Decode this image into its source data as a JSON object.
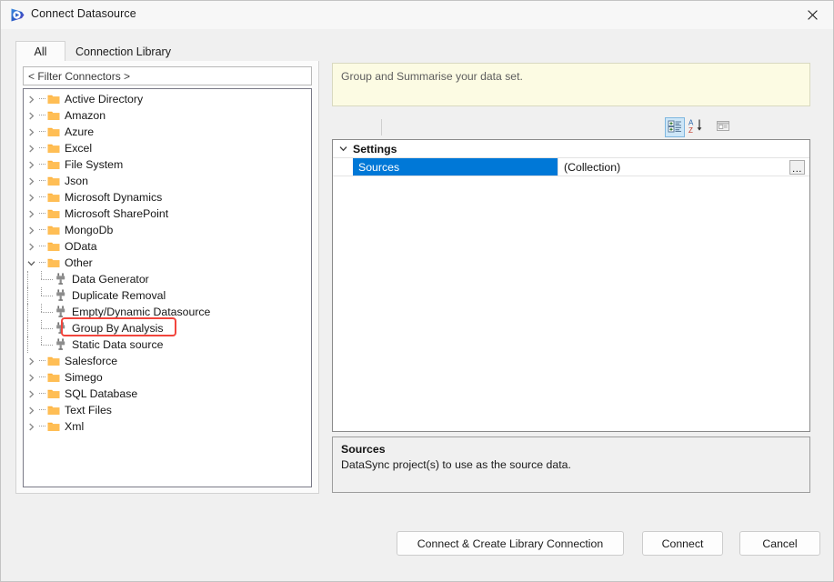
{
  "window": {
    "title": "Connect Datasource",
    "app_icon": "simego-play-icon",
    "close_icon": "close-icon"
  },
  "tabs": [
    {
      "label": "All",
      "selected": true
    },
    {
      "label": "Connection Library",
      "selected": false
    }
  ],
  "filter": {
    "placeholder": "< Filter Connectors >",
    "value": "< Filter Connectors >"
  },
  "tree": {
    "nodes": [
      {
        "label": "Active Directory",
        "type": "folder",
        "expanded": false,
        "level": 0
      },
      {
        "label": "Amazon",
        "type": "folder",
        "expanded": false,
        "level": 0
      },
      {
        "label": "Azure",
        "type": "folder",
        "expanded": false,
        "level": 0
      },
      {
        "label": "Excel",
        "type": "folder",
        "expanded": false,
        "level": 0
      },
      {
        "label": "File System",
        "type": "folder",
        "expanded": false,
        "level": 0
      },
      {
        "label": "Json",
        "type": "folder",
        "expanded": false,
        "level": 0
      },
      {
        "label": "Microsoft Dynamics",
        "type": "folder",
        "expanded": false,
        "level": 0
      },
      {
        "label": "Microsoft SharePoint",
        "type": "folder",
        "expanded": false,
        "level": 0
      },
      {
        "label": "MongoDb",
        "type": "folder",
        "expanded": false,
        "level": 0
      },
      {
        "label": "OData",
        "type": "folder",
        "expanded": false,
        "level": 0
      },
      {
        "label": "Other",
        "type": "folder",
        "expanded": true,
        "level": 0
      },
      {
        "label": "Data Generator",
        "type": "connector",
        "level": 1
      },
      {
        "label": "Duplicate Removal",
        "type": "connector",
        "level": 1
      },
      {
        "label": "Empty/Dynamic Datasource",
        "type": "connector",
        "level": 1
      },
      {
        "label": "Group By Analysis",
        "type": "connector",
        "level": 1,
        "highlighted": true
      },
      {
        "label": "Static Data source",
        "type": "connector",
        "level": 1,
        "last": true
      },
      {
        "label": "Salesforce",
        "type": "folder",
        "expanded": false,
        "level": 0
      },
      {
        "label": "Simego",
        "type": "folder",
        "expanded": false,
        "level": 0
      },
      {
        "label": "SQL Database",
        "type": "folder",
        "expanded": false,
        "level": 0
      },
      {
        "label": "Text Files",
        "type": "folder",
        "expanded": false,
        "level": 0
      },
      {
        "label": "Xml",
        "type": "folder",
        "expanded": false,
        "level": 0
      }
    ]
  },
  "description_banner": {
    "text": "Group and Summarise your data set."
  },
  "property_toolbar": {
    "buttons": [
      {
        "name": "categorized-view",
        "icon": "categorized-icon",
        "active": true
      },
      {
        "name": "alphabetical-view",
        "icon": "sort-az-icon",
        "active": false
      },
      {
        "name": "property-pages",
        "icon": "property-pages-icon",
        "active": false
      }
    ]
  },
  "property_grid": {
    "category": "Settings",
    "category_expanded": true,
    "rows": [
      {
        "name": "Sources",
        "value": "(Collection)",
        "selected": true,
        "has_ellipsis": true,
        "ellipsis_label": "..."
      }
    ]
  },
  "help_panel": {
    "title": "Sources",
    "body": "DataSync project(s) to use as the source data."
  },
  "footer": {
    "connect_create_label": "Connect & Create Library Connection",
    "connect_label": "Connect",
    "cancel_label": "Cancel"
  },
  "colors": {
    "selection_blue": "#0078d7",
    "annotation_red": "#f2453d",
    "folder_amber": "#ffb13b",
    "banner_yellow": "#fcfbe3"
  }
}
